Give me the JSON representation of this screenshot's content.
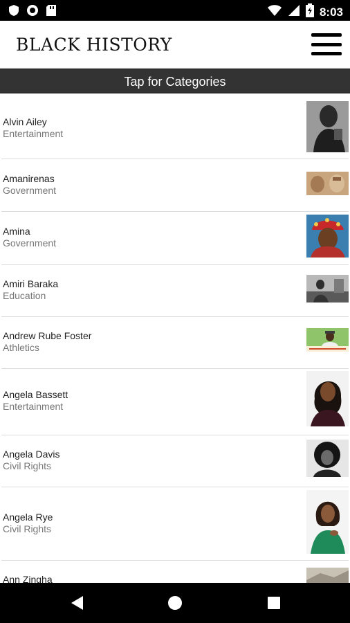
{
  "status_bar": {
    "time": "8:03",
    "left_icons": [
      "shield-icon",
      "circle-icon",
      "sd-card-icon"
    ],
    "right_icons": [
      "wifi-icon",
      "cellular-signal-icon",
      "battery-icon"
    ]
  },
  "header": {
    "title": "BLACK HISTORY",
    "menu_icon": "hamburger-menu-icon"
  },
  "categories_bar": {
    "label": "Tap for Categories"
  },
  "list": {
    "items": [
      {
        "name": "Alvin Ailey",
        "category": "Entertainment"
      },
      {
        "name": "Amanirenas",
        "category": "Government"
      },
      {
        "name": "Amina",
        "category": "Government"
      },
      {
        "name": "Amiri Baraka",
        "category": "Education"
      },
      {
        "name": "Andrew Rube Foster",
        "category": "Athletics"
      },
      {
        "name": "Angela Bassett",
        "category": "Entertainment"
      },
      {
        "name": "Angela Davis",
        "category": "Civil Rights"
      },
      {
        "name": "Angela Rye",
        "category": "Civil Rights"
      },
      {
        "name": "Ann Zingha",
        "category": ""
      }
    ]
  },
  "nav_bar": {
    "icons": [
      "back-icon",
      "home-icon",
      "recents-icon"
    ]
  },
  "colors": {
    "status_bar": "#000000",
    "categories_bar": "#333333",
    "name_text": "#222222",
    "category_text": "#777777",
    "separator": "#dcdcdc"
  }
}
